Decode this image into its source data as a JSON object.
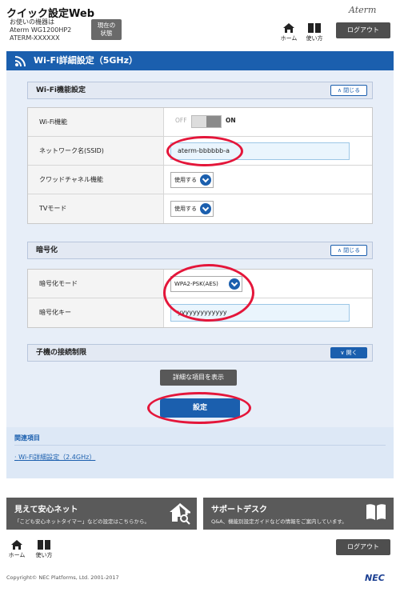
{
  "header": {
    "app_title": "クイック設定Web",
    "device_caption": "お使いの機器は",
    "device_model": "Aterm WG1200HP2",
    "device_id": "ATERM-XXXXXX",
    "status_button": "現在の\n状態",
    "brand": "Aterm",
    "home_label": "ホーム",
    "help_label": "使い方",
    "logout_label": "ログアウト"
  },
  "page": {
    "title": "Wi-Fi詳細設定（5GHz）"
  },
  "wifi_section": {
    "title": "Wi-Fi機能設定",
    "collapse_label": "閉じる",
    "rows": {
      "wifi_label": "Wi-Fi機能",
      "wifi_off": "OFF",
      "wifi_on": "ON",
      "ssid_label": "ネットワーク名(SSID)",
      "ssid_value": "aterm-bbbbbb-a",
      "quad_label": "クワッドチャネル機能",
      "quad_value": "使用する",
      "tv_label": "TVモード",
      "tv_value": "使用する"
    }
  },
  "encryption_section": {
    "title": "暗号化",
    "collapse_label": "閉じる",
    "mode_label": "暗号化モード",
    "mode_value": "WPA2-PSK(AES)",
    "key_label": "暗号化キー",
    "key_value": "yyyyyyyyyyyyy"
  },
  "restrict_section": {
    "title": "子機の接続制限",
    "open_label": "開く"
  },
  "actions": {
    "details_button": "詳細な項目を表示",
    "submit_button": "設定"
  },
  "related": {
    "title": "関連項目",
    "link": "Wi-Fi詳細設定（2.4GHz）"
  },
  "cards": {
    "left_title": "見えて安心ネット",
    "left_desc": "「こども安心ネットタイマー」などの設定はこちらから。",
    "right_title": "サポートデスク",
    "right_desc": "Q&A、機能別設定ガイドなどの情報をご案内しています。"
  },
  "footer": {
    "home_label": "ホーム",
    "help_label": "使い方",
    "logout_label": "ログアウト",
    "copyright": "Copyright© NEC Platforms, Ltd. 2001-2017",
    "nec_logo": "NEC"
  },
  "colors": {
    "primary": "#1b5fae",
    "highlight_ring": "#e4163a",
    "panel_bg": "#e7eef8"
  }
}
